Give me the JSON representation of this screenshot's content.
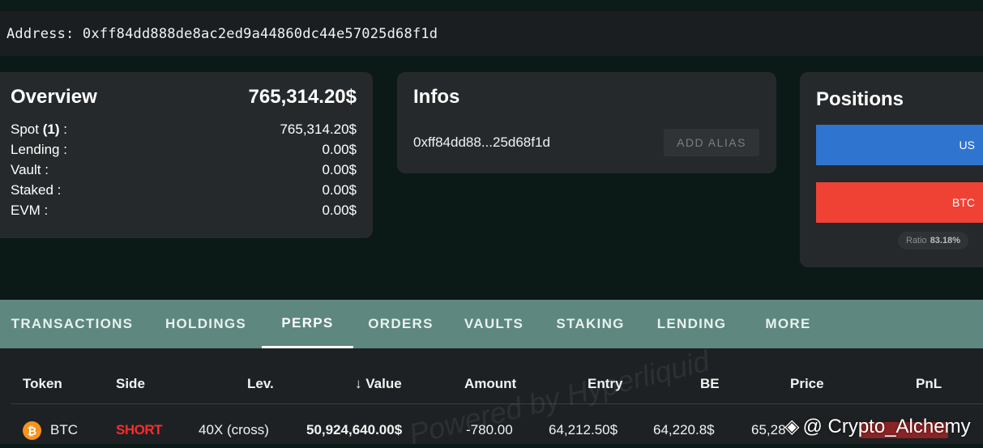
{
  "address": {
    "label": "Address: 0xff84dd888de8ac2ed9a44860dc44e57025d68f1d"
  },
  "overview": {
    "title": "Overview",
    "total": "765,314.20$",
    "rows": [
      {
        "label_prefix": "Spot ",
        "label_count": "(1)",
        "label_suffix": " :",
        "value": "765,314.20$"
      },
      {
        "label": "Lending :",
        "value": "0.00$"
      },
      {
        "label": "Vault :",
        "value": "0.00$"
      },
      {
        "label": "Staked :",
        "value": "0.00$"
      },
      {
        "label": "EVM :",
        "value": "0.00$"
      }
    ]
  },
  "infos": {
    "title": "Infos",
    "short_address": "0xff84dd88...25d68f1d",
    "add_alias_label": "ADD ALIAS"
  },
  "positions": {
    "title": "Positions",
    "bar_blue_label": "US",
    "bar_red_label": "BTC",
    "ratio_label": "Ratio",
    "ratio_value": "83.18%",
    "colors": {
      "long": "#2f74cf",
      "short": "#f04135"
    }
  },
  "tabs": [
    {
      "label": "TRANSACTIONS",
      "active": false
    },
    {
      "label": "HOLDINGS",
      "active": false
    },
    {
      "label": "PERPS",
      "active": true
    },
    {
      "label": "ORDERS",
      "active": false
    },
    {
      "label": "VAULTS",
      "active": false
    },
    {
      "label": "STAKING",
      "active": false
    },
    {
      "label": "LENDING",
      "active": false
    },
    {
      "label": "MORE",
      "active": false
    }
  ],
  "table": {
    "headers": {
      "token": "Token",
      "side": "Side",
      "lev": "Lev.",
      "value_arrow": "↓",
      "value": "Value",
      "amount": "Amount",
      "entry": "Entry",
      "be": "BE",
      "price": "Price",
      "pnl": "PnL"
    },
    "rows": [
      {
        "token_icon": "bitcoin-icon",
        "token_icon_glyph": "₿",
        "token": "BTC",
        "side": "SHORT",
        "lev": "40X (cross)",
        "value": "50,924,640.00$",
        "amount": "-780.00",
        "entry": "64,212.50$",
        "be": "64,220.8$",
        "price": "65,28"
      }
    ]
  },
  "watermark": {
    "text": "Powered by Hyperliquid",
    "brand_glyph": "◈",
    "brand": "@ Crypto_Alchemy"
  }
}
